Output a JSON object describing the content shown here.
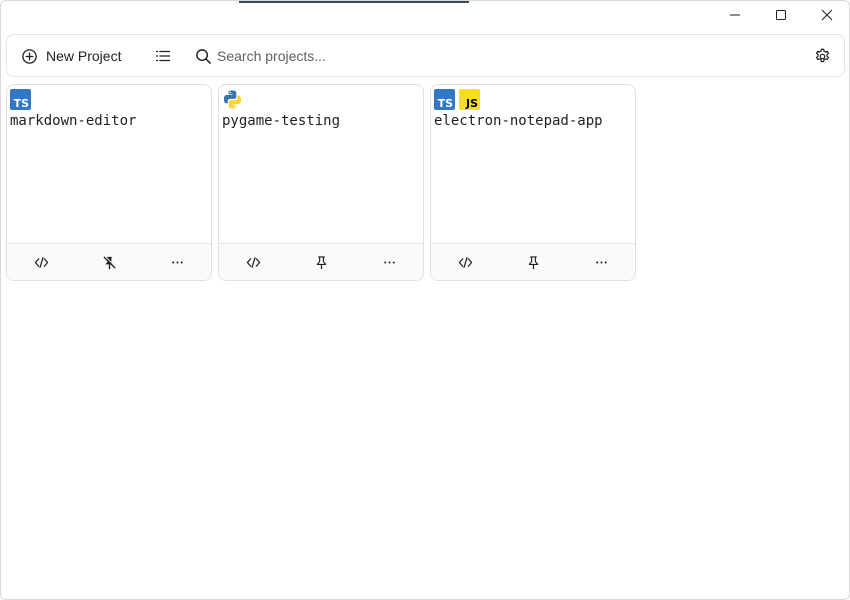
{
  "window": {
    "controls": [
      {
        "name": "minimize-button",
        "icon": "minimize-icon"
      },
      {
        "name": "maximize-button",
        "icon": "maximize-icon"
      },
      {
        "name": "close-button",
        "icon": "close-icon"
      }
    ]
  },
  "toolbar": {
    "new_project_label": "New Project",
    "new_project_icon": "plus-circle-icon",
    "list_view_icon": "list-icon",
    "search_icon": "search-icon",
    "search_placeholder": "Search projects...",
    "search_value": "",
    "settings_icon": "gear-icon"
  },
  "projects": [
    {
      "name": "markdown-editor",
      "languages": [
        "TS"
      ],
      "pinned": true,
      "actions": [
        "open-code",
        "unpin",
        "more"
      ]
    },
    {
      "name": "pygame-testing",
      "languages": [
        "Python"
      ],
      "pinned": false,
      "actions": [
        "open-code",
        "pin",
        "more"
      ]
    },
    {
      "name": "electron-notepad-app",
      "languages": [
        "TS",
        "JS"
      ],
      "pinned": false,
      "actions": [
        "open-code",
        "pin",
        "more"
      ]
    }
  ],
  "colors": {
    "ts_badge": "#3178c6",
    "js_badge": "#f7df1e",
    "python_blue": "#3776ab",
    "python_yellow": "#ffd43b",
    "border": "#e0e0e0"
  }
}
